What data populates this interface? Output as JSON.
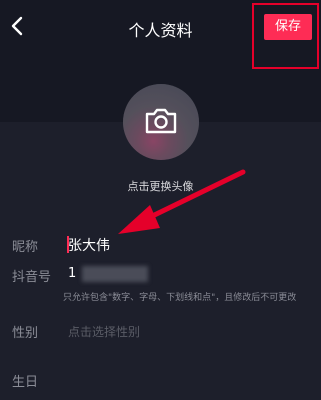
{
  "header": {
    "title": "个人资料",
    "save_label": "保存"
  },
  "avatar": {
    "caption": "点击更换头像"
  },
  "fields": {
    "nickname": {
      "label": "昵称",
      "value": "张大伟"
    },
    "douyin_id": {
      "label": "抖音号",
      "value": "1",
      "hint": "只允许包含\"数字、字母、下划线和点\"，且修改后不可更改"
    },
    "gender": {
      "label": "性别",
      "placeholder": "点击选择性别"
    },
    "birthday": {
      "label": "生日"
    }
  },
  "colors": {
    "background": "#161823",
    "panel": "#1d1f2b",
    "accent": "#fe2c55",
    "annotation": "#e5002a"
  },
  "icons": {
    "back": "chevron-left-icon",
    "camera": "camera-icon"
  }
}
